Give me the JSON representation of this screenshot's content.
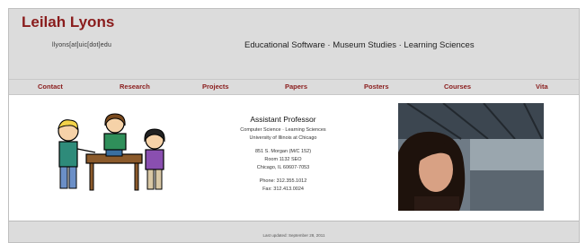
{
  "header": {
    "name": "Leilah Lyons",
    "email": "llyons[at]uic[dot]edu",
    "tagline": "Educational Software · Museum Studies · Learning Sciences"
  },
  "nav": {
    "items": [
      {
        "label": "Contact"
      },
      {
        "label": "Research"
      },
      {
        "label": "Projects"
      },
      {
        "label": "Papers"
      },
      {
        "label": "Posters"
      },
      {
        "label": "Courses"
      },
      {
        "label": "Vita"
      }
    ]
  },
  "info": {
    "title": "Assistant Professor",
    "dept": "Computer Science · Learning Sciences",
    "university": "University of Illinois at Chicago",
    "address1": "851 S. Morgan (M/C 152)",
    "address2": "Room 1132 SEO",
    "address3": "Chicago, IL 60607-7053",
    "phone": "Phone: 312.355.1012",
    "fax": "Fax: 312.413.0024"
  },
  "footer": {
    "text": "Last updated: September 28, 2011"
  },
  "colors": {
    "accent": "#8a1c1c",
    "header_bg": "#dcdcdc"
  },
  "images": {
    "illustration": "cartoon-children-at-table",
    "photo": "portrait-train-station"
  }
}
